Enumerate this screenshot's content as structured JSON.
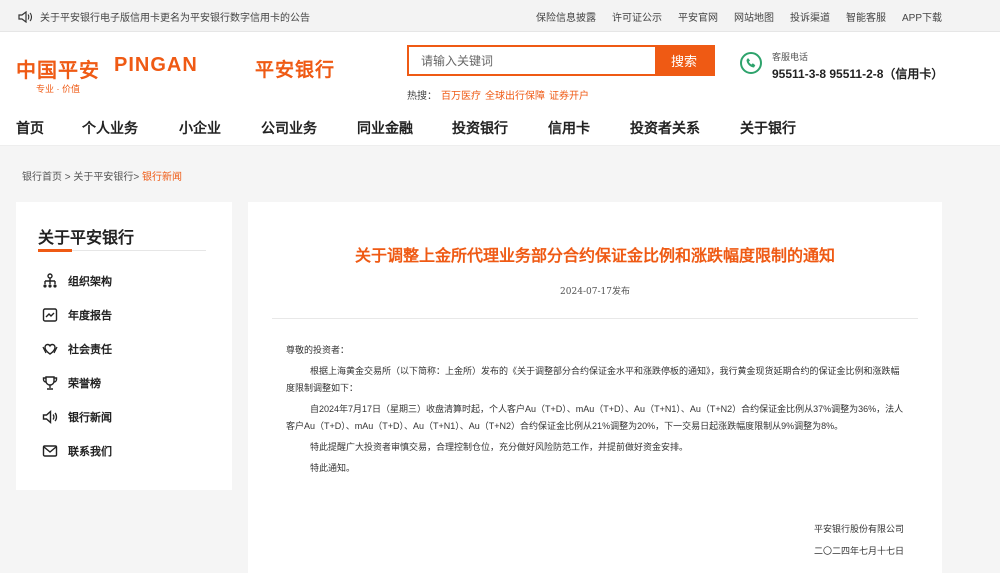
{
  "topbar": {
    "notice": "关于平安银行电子版信用卡更名为平安银行数字信用卡的公告",
    "links": [
      "保险信息披露",
      "许可证公示",
      "平安官网",
      "网站地图",
      "投诉渠道",
      "智能客服",
      "APP下载"
    ]
  },
  "header": {
    "logo_cn": "中国平安",
    "logo_en": "PINGAN",
    "logo_slogan": "专业 · 价值",
    "logo_bank": "平安银行",
    "search_placeholder": "请输入关键词",
    "search_button": "搜索",
    "hot_label": "热搜：",
    "hot_items": [
      "百万医疗",
      "全球出行保障",
      "证券开户"
    ],
    "service_label": "客服电话",
    "service_numbers": "95511-3-8 95511-2-8（信用卡）"
  },
  "nav": [
    "首页",
    "个人业务",
    "小企业",
    "公司业务",
    "同业金融",
    "投资银行",
    "信用卡",
    "投资者关系",
    "关于银行"
  ],
  "breadcrumb": {
    "home": "银行首页",
    "sep": ">",
    "parent": "关于平安银行",
    "current": "银行新闻"
  },
  "sidebar": {
    "title": "关于平安银行",
    "items": [
      {
        "label": "组织架构",
        "icon": "org-chart-icon"
      },
      {
        "label": "年度报告",
        "icon": "report-chart-icon"
      },
      {
        "label": "社会责任",
        "icon": "heart-hands-icon"
      },
      {
        "label": "荣誉榜",
        "icon": "trophy-icon"
      },
      {
        "label": "银行新闻",
        "icon": "speaker-icon"
      },
      {
        "label": "联系我们",
        "icon": "mail-icon"
      }
    ]
  },
  "article": {
    "title": "关于调整上金所代理业务部分合约保证金比例和涨跌幅度限制的通知",
    "date": "2024-07-17发布",
    "greeting": "尊敬的投资者：",
    "p1": "根据上海黄金交易所（以下简称：上金所）发布的《关于调整部分合约保证金水平和涨跌停板的通知》，我行黄金现货延期合约的保证金比例和涨跌幅度限制调整如下：",
    "p2": "自2024年7月17日（星期三）收盘清算时起，个人客户Au（T+D）、mAu（T+D）、Au（T+N1）、Au（T+N2）合约保证金比例从37%调整为36%，法人客户Au（T+D）、mAu（T+D）、Au（T+N1）、Au（T+N2）合约保证金比例从21%调整为20%，下一交易日起涨跌幅度限制从9%调整为8%。",
    "p3": "特此提醒广大投资者审慎交易，合理控制仓位，充分做好风险防范工作，并提前做好资金安排。",
    "p4": "特此通知。",
    "signature": "平安银行股份有限公司",
    "sign_date": "二〇二四年七月十七日"
  }
}
